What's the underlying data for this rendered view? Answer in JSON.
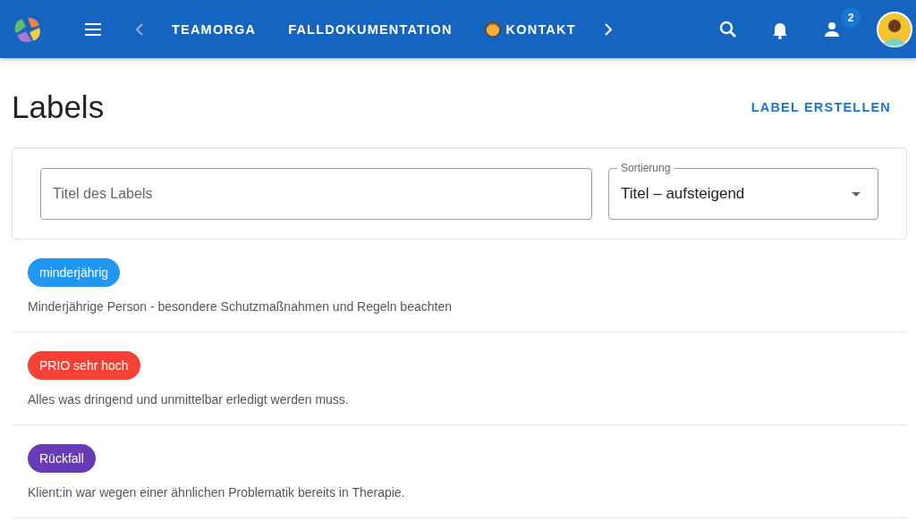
{
  "top_bar": {
    "nav_links": [
      {
        "label": "TEAMORGA",
        "kind": "text"
      },
      {
        "label": "FALLDOKUMENTATION",
        "kind": "text"
      },
      {
        "label": "KONTAKT",
        "kind": "person"
      }
    ],
    "notification_badge": "2"
  },
  "page": {
    "title": "Labels",
    "create_button": "LABEL ERSTELLEN"
  },
  "filters": {
    "title_field": {
      "placeholder": "Titel des Labels"
    },
    "sort_field": {
      "label": "Sortierung",
      "value": "Titel – aufsteigend"
    }
  },
  "labels": [
    {
      "name": "minderjährig",
      "color": "#2196f3",
      "description": "Minderjährige Person - besondere Schutzmaßnahmen und Regeln beachten"
    },
    {
      "name": "PRIO sehr hoch",
      "color": "#f44336",
      "description": "Alles was dringend und unmittelbar erledigt werden muss."
    },
    {
      "name": "Rückfall",
      "color": "#673ab7",
      "description": "Klient:in war wegen einer ähnlichen Problematik bereits in Therapie."
    }
  ]
}
